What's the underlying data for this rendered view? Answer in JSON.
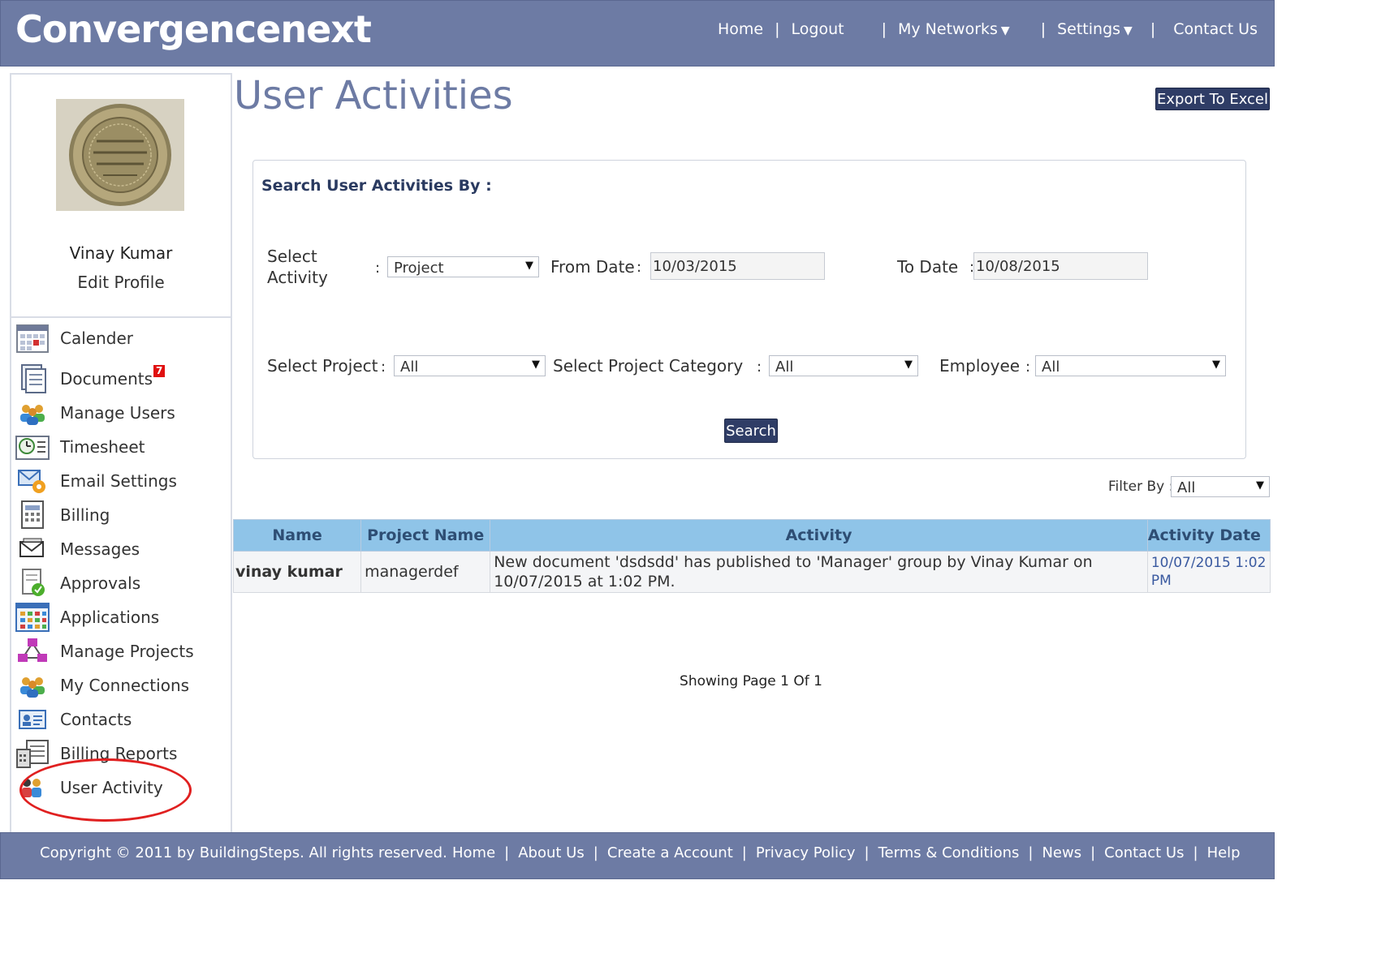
{
  "header": {
    "logo": "Convergencenext",
    "nav": {
      "home": "Home",
      "logout": "Logout",
      "my_networks": "My Networks",
      "settings": "Settings",
      "contact_us": "Contact Us"
    }
  },
  "sidebar": {
    "profile_name": "Vinay Kumar",
    "edit_profile": "Edit Profile",
    "items": [
      {
        "label": "Calender",
        "icon": "calendar-icon"
      },
      {
        "label": "Documents",
        "icon": "documents-icon",
        "badge": "7"
      },
      {
        "label": "Manage Users",
        "icon": "users-icon"
      },
      {
        "label": "Timesheet",
        "icon": "timesheet-icon"
      },
      {
        "label": "Email Settings",
        "icon": "email-settings-icon"
      },
      {
        "label": "Billing",
        "icon": "billing-icon"
      },
      {
        "label": "Messages",
        "icon": "messages-icon"
      },
      {
        "label": "Approvals",
        "icon": "approvals-icon"
      },
      {
        "label": "Applications",
        "icon": "applications-icon"
      },
      {
        "label": "Manage Projects",
        "icon": "projects-icon"
      },
      {
        "label": "My Connections",
        "icon": "connections-icon"
      },
      {
        "label": "Contacts",
        "icon": "contacts-icon"
      },
      {
        "label": "Billing Reports",
        "icon": "billing-reports-icon"
      },
      {
        "label": "User Activity",
        "icon": "user-activity-icon"
      }
    ]
  },
  "main": {
    "title": "User Activities",
    "export_label": "Export To Excel",
    "search": {
      "heading": "Search User Activities By :",
      "select_activity_label": "Select Activity",
      "select_activity_value": "Project",
      "from_date_label": "From Date",
      "from_date_value": "10/03/2015",
      "to_date_label": "To Date",
      "to_date_value": "10/08/2015",
      "select_project_label": "Select Project",
      "select_project_value": "All",
      "project_category_label": "Select Project Category",
      "project_category_value": "All",
      "employee_label": "Employee",
      "employee_value": "All",
      "search_button": "Search"
    },
    "filter": {
      "label": "Filter By :",
      "value": "All"
    },
    "table": {
      "columns": [
        "Name",
        "Project Name",
        "Activity",
        "Activity Date"
      ],
      "rows": [
        {
          "name": "vinay kumar",
          "project": "managerdef",
          "activity": "New document 'dsdsdd' has published to 'Manager' group by Vinay Kumar on 10/07/2015 at 1:02 PM.",
          "date": "10/07/2015 1:02 PM"
        }
      ]
    },
    "pager": "Showing Page 1 Of 1"
  },
  "footer": {
    "copyright": "Copyright © 2011 by BuildingSteps. All rights reserved.",
    "links": [
      "Home",
      "About Us",
      "Create a Account",
      "Privacy Policy",
      "Terms & Conditions",
      "News",
      "Contact Us",
      "Help"
    ]
  },
  "colors": {
    "header_bg": "#6d7ba4",
    "title_color": "#6d7ba4",
    "button_bg": "#2f3d66",
    "table_header_bg": "#8fc4e8",
    "highlight_ring": "#e02020",
    "badge": "#e01010"
  }
}
